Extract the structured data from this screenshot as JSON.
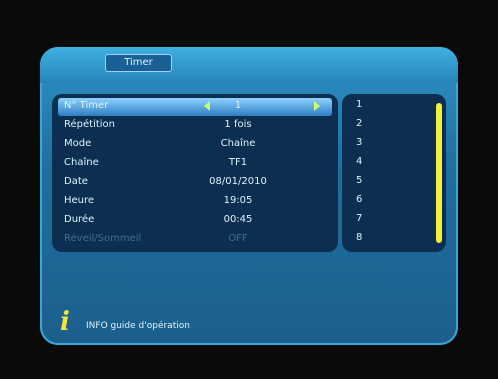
{
  "header": {
    "tab_label": "Timer"
  },
  "rows": [
    {
      "label": "N° Timer",
      "value": "1"
    },
    {
      "label": "Répétition",
      "value": "1 fois"
    },
    {
      "label": "Mode",
      "value": "Chaîne"
    },
    {
      "label": "Chaîne",
      "value": "TF1"
    },
    {
      "label": "Date",
      "value": "08/01/2010"
    },
    {
      "label": "Heure",
      "value": "19:05"
    },
    {
      "label": "Durée",
      "value": "00:45"
    },
    {
      "label": "Réveil/Sommeil",
      "value": "OFF"
    }
  ],
  "side_list": [
    "1",
    "2",
    "3",
    "4",
    "5",
    "6",
    "7",
    "8"
  ],
  "footer": {
    "info_text": "INFO guide d'opération"
  },
  "icons": {
    "info": "info-icon",
    "left_arrow": "triangle-left-icon",
    "right_arrow": "triangle-right-icon"
  },
  "colors": {
    "panel": "#2585b9",
    "selection": "#8ed1ff",
    "accent": "#c9ff63",
    "scrollbar": "#f3ee3a"
  }
}
